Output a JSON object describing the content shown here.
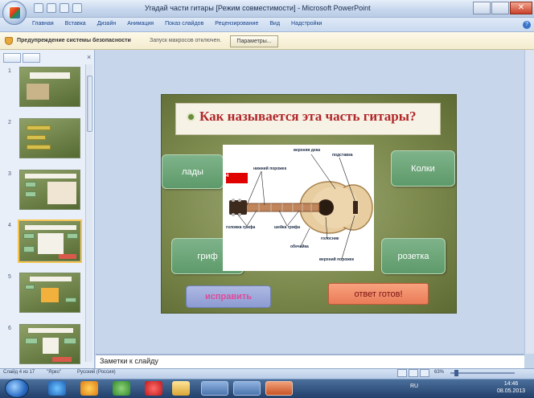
{
  "window": {
    "title": "Угадай части гитары [Режим совместимости] - Microsoft PowerPoint"
  },
  "ribbon": {
    "tabs": [
      "Главная",
      "Вставка",
      "Дизайн",
      "Анимация",
      "Показ слайдов",
      "Рецензирование",
      "Вид",
      "Надстройки"
    ]
  },
  "security_bar": {
    "title": "Предупреждение системы безопасности",
    "message": "Запуск макросов отключен.",
    "options_button": "Параметры..."
  },
  "slides_pane": {
    "numbers": [
      "1",
      "2",
      "3",
      "4",
      "5",
      "6"
    ],
    "selected_index": 4
  },
  "slide": {
    "title": "Как называется эта часть гитары?",
    "labels": {
      "frets": "лады",
      "pegs": "Колки",
      "neck": "гриф",
      "rosette": "розетка"
    },
    "diagram_labels": {
      "top_deck": "верхняя дека",
      "bridge": "подставка",
      "lower_nut": "нижний порожек",
      "headstock": "головка грифа",
      "neck_heel": "шейка грифа",
      "shell": "обечайка",
      "saddle_lower": "голосник",
      "upper_nut": "верхний порожек"
    },
    "red_marker": "4",
    "fix_button": "исправить",
    "ready_button": "ответ готов!"
  },
  "notes": {
    "placeholder": "Заметки к слайду"
  },
  "status_bar": {
    "slide_info": "Слайд 4 из 17",
    "theme": "\"Ярко\"",
    "language": "Русский (Россия)",
    "zoom": "63%"
  },
  "taskbar": {
    "time": "14:46",
    "date": "08.05.2013",
    "language": "RU"
  }
}
